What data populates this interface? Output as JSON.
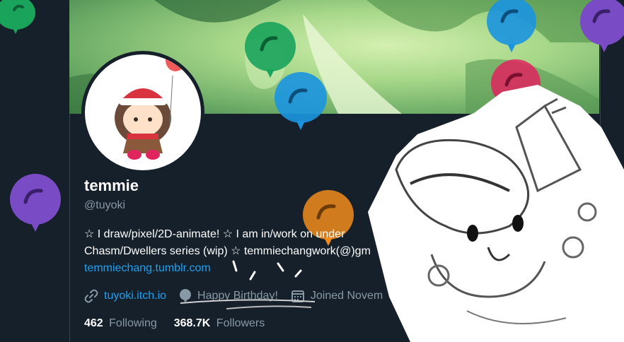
{
  "profile": {
    "display_name": "temmie",
    "handle": "@tuyoki",
    "bio_line_1": "☆ I draw/pixel/2D-animate! ☆ I am in/work on under",
    "bio_line_2": "Chasm/Dwellers series (wip) ☆ temmiechangwork(@)gm",
    "bio_link": "temmiechang.tumblr.com",
    "website": "tuyoki.itch.io",
    "birthday": "Happy Birthday!",
    "joined": "Joined Novem",
    "following_count": "462",
    "following_label": "Following",
    "followers_count": "368.7K",
    "followers_label": "Followers"
  },
  "icons": {
    "website": "link-icon",
    "birthday": "balloon-icon",
    "joined": "calendar-icon"
  },
  "colors": {
    "background": "#15202b",
    "accent": "#1da1f2",
    "secondary_text": "#8899a6",
    "balloon_green": "#1aa35b",
    "balloon_blue": "#1b95e0",
    "balloon_purple": "#794bc4",
    "balloon_red": "#e0245e",
    "balloon_orange": "#f18c1c"
  }
}
